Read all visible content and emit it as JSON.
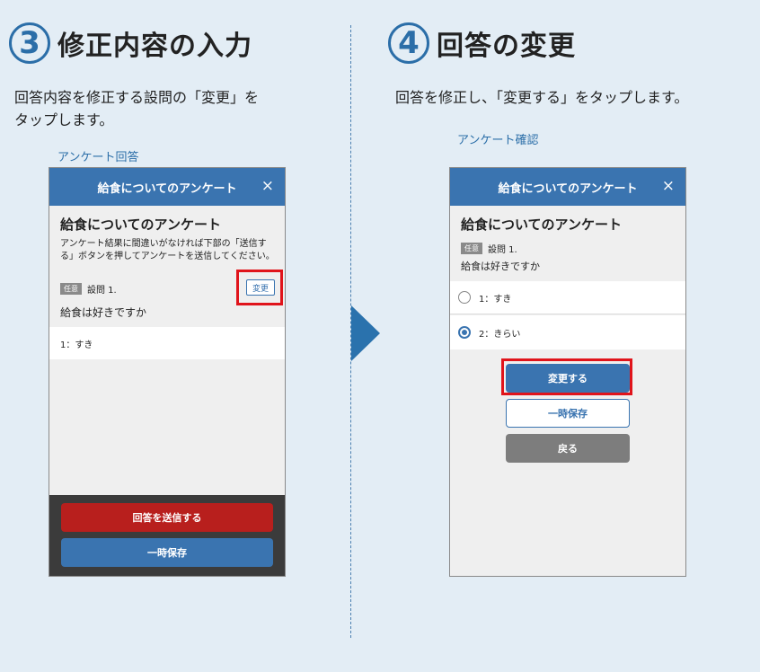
{
  "left": {
    "step_number": "3",
    "step_title": "修正内容の入力",
    "desc_line1": "回答内容を修正する設問の「変更」を",
    "desc_line2": "タップします。",
    "caption": "アンケート回答",
    "phone": {
      "header": "給食についてのアンケート",
      "close": "×",
      "title": "給食についてのアンケート",
      "note_line1": "アンケート結果に間違いがなければ下部の「送信す",
      "note_line2": "る」ボタンを押してアンケートを送信してください。",
      "tag": "任意",
      "question_no": "設問 1.",
      "change_label": "変更",
      "question": "給食は好きですか",
      "answer": "1：すき",
      "submit_label": "回答を送信する",
      "save_label": "一時保存"
    }
  },
  "right": {
    "step_number": "4",
    "step_title": "回答の変更",
    "desc": "回答を修正し、「変更する」をタップします。",
    "caption": "アンケート確認",
    "phone": {
      "header": "給食についてのアンケート",
      "close": "×",
      "title": "給食についてのアンケート",
      "tag": "任意",
      "question_no": "設問 1.",
      "question": "給食は好きですか",
      "options": [
        "1：すき",
        "2：きらい"
      ],
      "selected_option": "2：きらい",
      "change_label": "変更する",
      "save_label": "一時保存",
      "back_label": "戻る"
    }
  },
  "colors": {
    "accent": "#3a74b0",
    "highlight": "#e0141b",
    "submit": "#b81f1d",
    "background": "#e3edf5"
  }
}
